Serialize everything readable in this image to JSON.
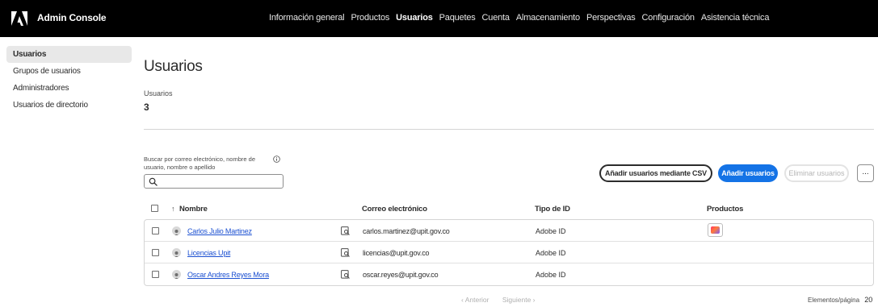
{
  "header": {
    "app_title": "Admin Console",
    "nav": [
      {
        "label": "Información general",
        "active": false
      },
      {
        "label": "Productos",
        "active": false
      },
      {
        "label": "Usuarios",
        "active": true
      },
      {
        "label": "Paquetes",
        "active": false
      },
      {
        "label": "Cuenta",
        "active": false
      },
      {
        "label": "Almacenamiento",
        "active": false
      },
      {
        "label": "Perspectivas",
        "active": false
      },
      {
        "label": "Configuración",
        "active": false
      },
      {
        "label": "Asistencia técnica",
        "active": false
      }
    ]
  },
  "sidebar": {
    "items": [
      {
        "label": "Usuarios",
        "active": true
      },
      {
        "label": "Grupos de usuarios",
        "active": false
      },
      {
        "label": "Administradores",
        "active": false
      },
      {
        "label": "Usuarios de directorio",
        "active": false
      }
    ]
  },
  "main": {
    "title": "Usuarios",
    "count_label": "Usuarios",
    "count_value": "3",
    "search_label": "Buscar por correo electrónico, nombre de usuario, nombre o apellido",
    "search_value": "",
    "buttons": {
      "csv": "Añadir usuarios mediante CSV",
      "add": "Añadir usuarios",
      "remove": "Eliminar usuarios",
      "more": "..."
    },
    "table": {
      "columns": {
        "name": "Nombre",
        "email": "Correo electrónico",
        "id_type": "Tipo de ID",
        "products": "Productos"
      },
      "rows": [
        {
          "name": "Carlos Julio Martinez",
          "email": "carlos.martinez@upit.gov.co",
          "id_type": "Adobe ID",
          "has_product": true
        },
        {
          "name": "Licencias Upit",
          "email": "licencias@upit.gov.co",
          "id_type": "Adobe ID",
          "has_product": false
        },
        {
          "name": "Oscar Andres Reyes Mora",
          "email": "oscar.reyes@upit.gov.co",
          "id_type": "Adobe ID",
          "has_product": false
        }
      ]
    },
    "pager": {
      "prev": "‹  Anterior",
      "next": "Siguiente  ›",
      "per_page_label": "Elementos/página",
      "per_page_value": "20",
      "per_page_chevron": "⌄"
    }
  },
  "colors": {
    "accent": "#1473e6",
    "link": "#1a4fd1",
    "topbar": "#000000"
  },
  "icons": {
    "logo": "adobe-logo",
    "info": "info-icon",
    "search": "search-icon",
    "detail": "detail-icon",
    "avatar": "user-avatar-icon",
    "product": "creative-cloud-icon"
  }
}
